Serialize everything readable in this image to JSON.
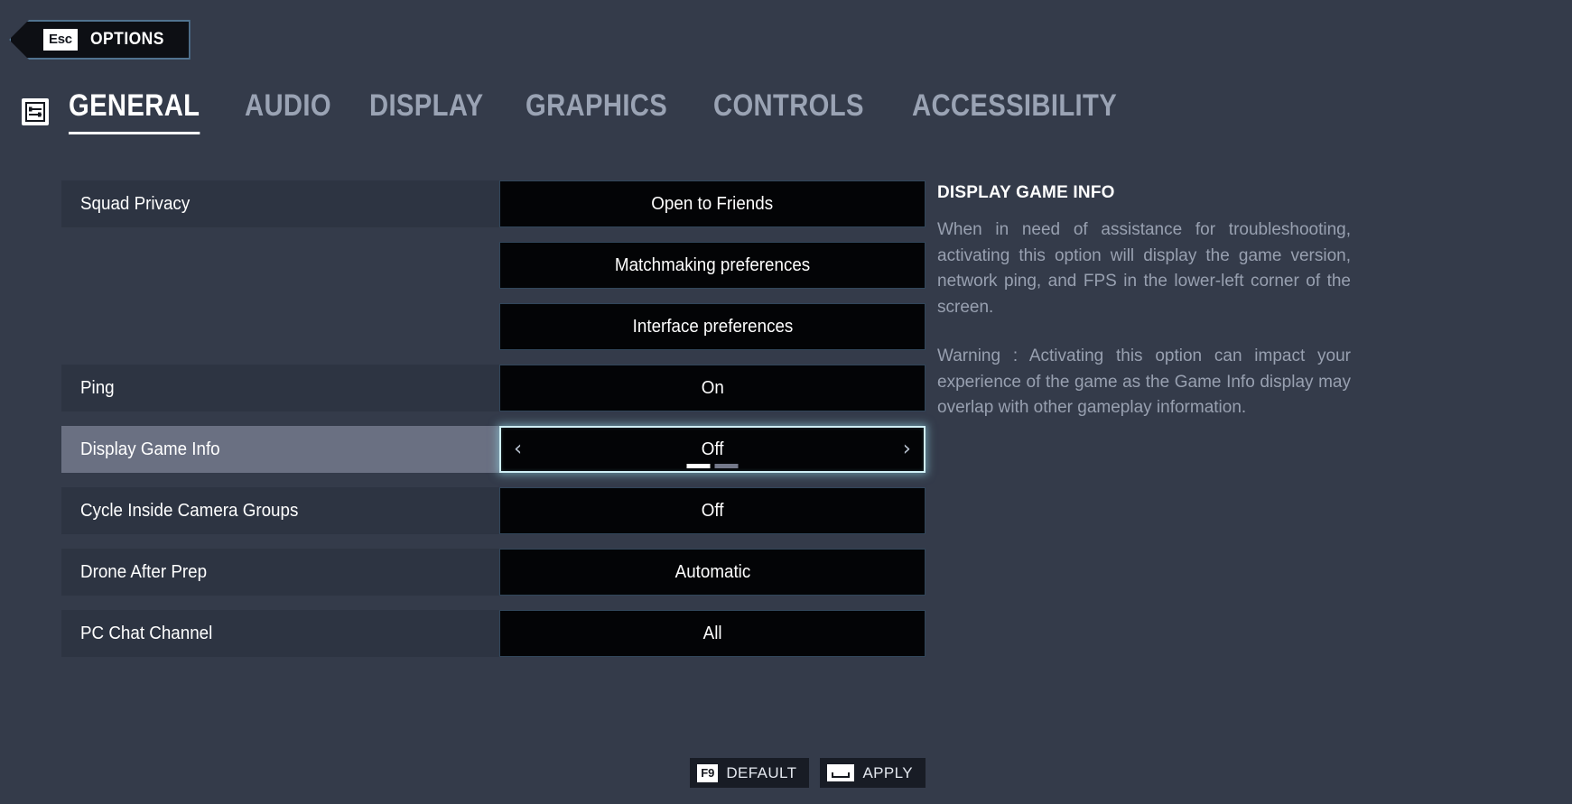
{
  "esc_banner": {
    "key": "Esc",
    "label": "OPTIONS",
    "icon": "back-chevron-icon"
  },
  "tabbar": {
    "icon": "sliders-settings-icon",
    "tabs": [
      {
        "label": "GENERAL",
        "active": true
      },
      {
        "label": "AUDIO",
        "active": false
      },
      {
        "label": "DISPLAY",
        "active": false
      },
      {
        "label": "GRAPHICS",
        "active": false
      },
      {
        "label": "CONTROLS",
        "active": false
      },
      {
        "label": "ACCESSIBILITY",
        "active": false
      }
    ]
  },
  "settings": {
    "rows": [
      {
        "label": "Squad Privacy",
        "value": "Open to Friends",
        "selected": false,
        "blank": false
      },
      {
        "label": "",
        "value": "Matchmaking preferences",
        "selected": false,
        "blank": true
      },
      {
        "label": "",
        "value": "Interface preferences",
        "selected": false,
        "blank": true
      },
      {
        "label": "Ping",
        "value": "On",
        "selected": false,
        "blank": false
      },
      {
        "label": "Display Game Info",
        "value": "Off",
        "selected": true,
        "blank": false
      },
      {
        "label": "Cycle Inside Camera Groups",
        "value": "Off",
        "selected": false,
        "blank": false
      },
      {
        "label": "Drone After Prep",
        "value": "Automatic",
        "selected": false,
        "blank": false
      },
      {
        "label": "PC Chat Channel",
        "value": "All",
        "selected": false,
        "blank": false
      }
    ],
    "arrows": {
      "left": "‹",
      "right": "›"
    },
    "page_indicator": {
      "total": 2,
      "active_index": 0
    }
  },
  "description": {
    "title": "DISPLAY GAME INFO",
    "paragraphs": [
      "When in need of assistance for troubleshooting, activating this option will display the game version, network ping, and FPS in the lower-left corner of the screen.",
      "Warning : Activating this option can impact your experience of the game as the Game Info display may overlap with other gameplay information."
    ]
  },
  "footer": {
    "default_button": {
      "key": "F9",
      "label": "DEFAULT"
    },
    "apply_button": {
      "key": "space-bar-icon",
      "label": "APPLY"
    }
  },
  "colors": {
    "background": "#343b4a",
    "row_label_bg": "#2d3442",
    "row_selected_bg": "#6a7082",
    "value_bg": "#030406",
    "value_border": "#31465a",
    "selected_glow": "#cfeff5",
    "text_primary": "#ffffff",
    "text_muted": "#98a0b0",
    "tab_inactive": "#9aa3b4",
    "banner_border": "#51738f"
  }
}
